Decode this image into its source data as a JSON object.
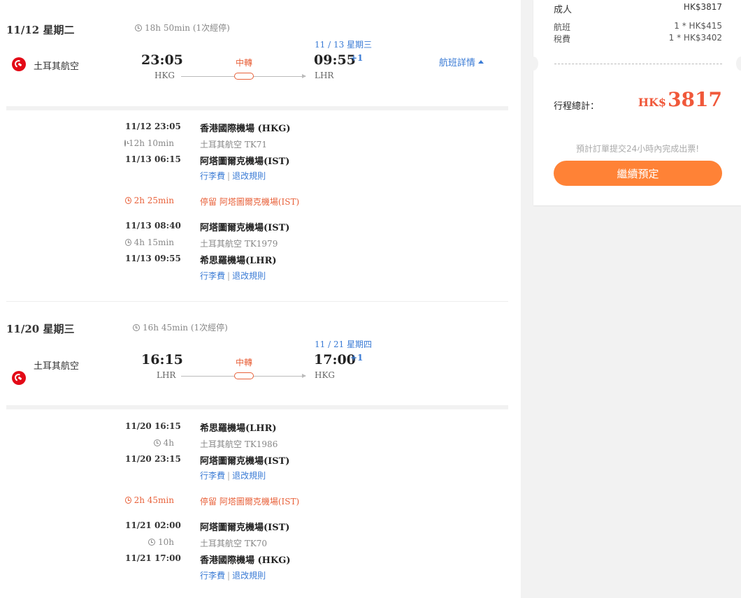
{
  "outbound": {
    "date": "11/12 星期二",
    "duration": "18h 50min (1次經停)",
    "airline": "土耳其航空",
    "dep_time": "23:05",
    "dep_code": "HKG",
    "arr_date": "11 / 13 星期三",
    "arr_time": "09:55",
    "plus_day": "+1",
    "arr_code": "LHR",
    "transfer": "中轉",
    "details_label": "航班詳情",
    "segments": [
      {
        "dep_time": "11/12 23:05",
        "dep_airport": "香港國際機場 (HKG)",
        "duration": "12h 10min",
        "flight": "土耳其航空 TK71",
        "arr_time": "11/13 06:15",
        "arr_airport": "阿塔圖爾克機場(IST)",
        "baggage": "行李費",
        "rules": "退改規則"
      },
      {
        "layover_duration": "2h 25min",
        "layover_text": "停留 阿塔圖爾克機場(IST)"
      },
      {
        "dep_time": "11/13 08:40",
        "dep_airport": "阿塔圖爾克機場(IST)",
        "duration": "4h 15min",
        "flight": "土耳其航空 TK1979",
        "arr_time": "11/13 09:55",
        "arr_airport": "希思羅機場(LHR)",
        "baggage": "行李費",
        "rules": "退改規則"
      }
    ]
  },
  "inbound": {
    "date": "11/20 星期三",
    "duration": "16h 45min (1次經停)",
    "airline": "土耳其航空",
    "dep_time": "16:15",
    "dep_code": "LHR",
    "arr_date": "11 / 21 星期四",
    "arr_time": "17:00",
    "plus_day": "+1",
    "arr_code": "HKG",
    "transfer": "中轉",
    "segments": [
      {
        "dep_time": "11/20 16:15",
        "dep_airport": "希思羅機場(LHR)",
        "duration": "4h",
        "flight": "土耳其航空 TK1986",
        "arr_time": "11/20 23:15",
        "arr_airport": "阿塔圖爾克機場(IST)",
        "baggage": "行李費",
        "rules": "退改規則"
      },
      {
        "layover_duration": "2h 45min",
        "layover_text": "停留 阿塔圖爾克機場(IST)"
      },
      {
        "dep_time": "11/21 02:00",
        "dep_airport": "阿塔圖爾克機場(IST)",
        "duration": "10h",
        "flight": "土耳其航空 TK70",
        "arr_time": "11/21 17:00",
        "arr_airport": "香港國際機場 (HKG)",
        "baggage": "行李費",
        "rules": "退改規則"
      }
    ]
  },
  "summary": {
    "adult_label": "成人",
    "adult_price": "HK$3817",
    "fare_label": "航班",
    "fare_value": "1 * HK$415",
    "tax_label": "稅費",
    "tax_value": "1 * HK$3402",
    "total_label": "行程總計：",
    "total_currency": "HK$",
    "total_amount": "3817",
    "note": "預計訂單提交24小時內完成出票!",
    "continue_label": "繼續預定"
  },
  "colors": {
    "accent": "#ff8236",
    "price": "#f0583a",
    "link": "#3a7bd5",
    "brand": "#e30a17"
  }
}
